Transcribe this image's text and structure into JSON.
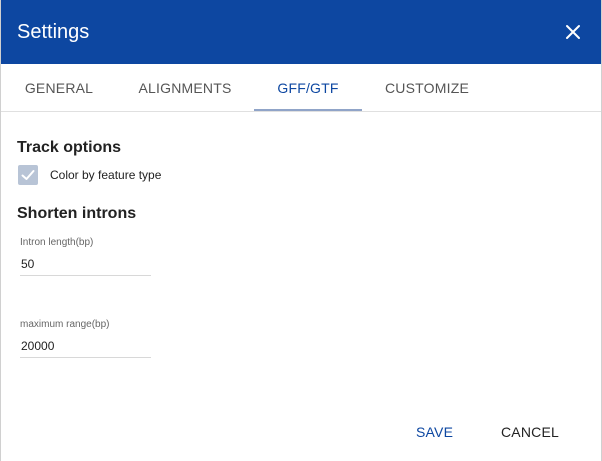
{
  "dialog": {
    "title": "Settings",
    "close_icon": "close-icon"
  },
  "tabs": [
    {
      "label": "GENERAL",
      "active": false
    },
    {
      "label": "ALIGNMENTS",
      "active": false
    },
    {
      "label": "GFF/GTF",
      "active": true
    },
    {
      "label": "CUSTOMIZE",
      "active": false
    }
  ],
  "track_options": {
    "heading": "Track options",
    "color_by_feature": {
      "label": "Color by feature type",
      "checked": true
    }
  },
  "shorten_introns": {
    "heading": "Shorten introns",
    "intron_length": {
      "label": "Intron length(bp)",
      "value": "50"
    },
    "maximum_range": {
      "label": "maximum range(bp)",
      "value": "20000"
    }
  },
  "actions": {
    "save_label": "SAVE",
    "cancel_label": "CANCEL"
  },
  "colors": {
    "header": "#0d47a1",
    "accent": "#0d47a1",
    "checkbox": "#b8c4d6"
  }
}
